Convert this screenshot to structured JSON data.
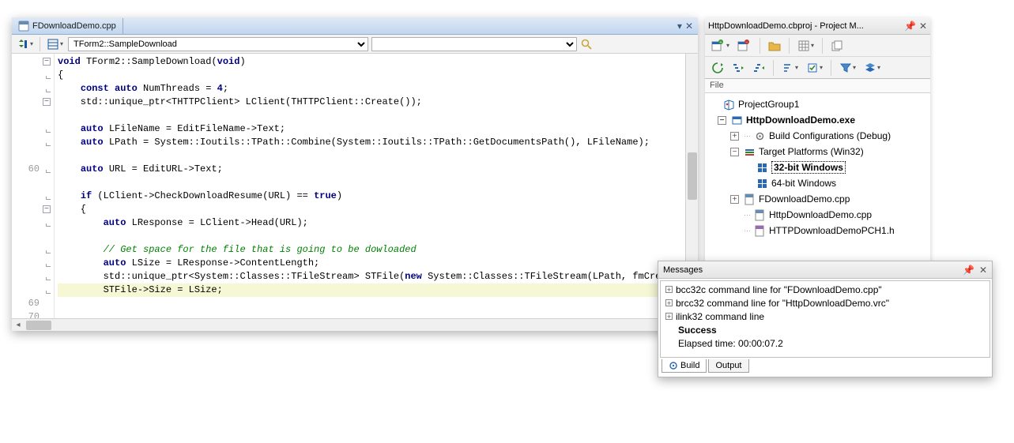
{
  "editor": {
    "tab_label": "FDownloadDemo.cpp",
    "nav_combo": "TForm2::SampleDownload",
    "line_numbers": [
      "",
      "",
      "",
      "",
      "",
      "",
      "",
      "",
      "60",
      "",
      "",
      "",
      "",
      "",
      "",
      "",
      "",
      "",
      "69",
      "70"
    ],
    "code_lines": [
      {
        "t": "[[kw:void]] TForm2::SampleDownload([[kw:void]])"
      },
      {
        "t": "{"
      },
      {
        "t": "    [[kw:const auto]] NumThreads = [[num:4]];"
      },
      {
        "t": "    std::unique_ptr<THTTPClient> LClient(THTTPClient::Create());"
      },
      {
        "t": ""
      },
      {
        "t": "    [[kw:auto]] LFileName = EditFileName->Text;"
      },
      {
        "t": "    [[kw:auto]] LPath = System::Ioutils::TPath::Combine(System::Ioutils::TPath::GetDocumentsPath(), LFileName);"
      },
      {
        "t": ""
      },
      {
        "t": "    [[kw:auto]] URL = EditURL->Text;"
      },
      {
        "t": ""
      },
      {
        "t": "    [[kw:if]] (LClient->CheckDownloadResume(URL) == [[kw:true]])"
      },
      {
        "t": "    {"
      },
      {
        "t": "        [[kw:auto]] LResponse = LClient->Head(URL);"
      },
      {
        "t": ""
      },
      {
        "t": "        [[cmt:// Get space for the file that is going to be dowloaded]]"
      },
      {
        "t": "        [[kw:auto]] LSize = LResponse->ContentLength;"
      },
      {
        "t": "        std::unique_ptr<System::Classes::TFileStream> STFile([[kw:new]] System::Classes::TFileStream(LPath, fmCreate));"
      },
      {
        "t": "        STFile->Size = LSize;",
        "hl": true
      },
      {
        "t": ""
      }
    ],
    "fold_marks": [
      {
        "line": 0,
        "type": "minus"
      },
      {
        "line": 1,
        "type": "line"
      },
      {
        "line": 2,
        "type": "line"
      },
      {
        "line": 3,
        "type": "minus"
      },
      {
        "line": 5,
        "type": "line"
      },
      {
        "line": 6,
        "type": "line"
      },
      {
        "line": 8,
        "type": "line"
      },
      {
        "line": 10,
        "type": "line"
      },
      {
        "line": 11,
        "type": "minus"
      },
      {
        "line": 12,
        "type": "line"
      },
      {
        "line": 14,
        "type": "line"
      },
      {
        "line": 15,
        "type": "line"
      },
      {
        "line": 16,
        "type": "line"
      },
      {
        "line": 17,
        "type": "line"
      }
    ]
  },
  "projman": {
    "title": "HttpDownloadDemo.cbproj - Project M...",
    "heading": "File",
    "tree": [
      {
        "indent": 0,
        "label": "ProjectGroup1",
        "icon": "group",
        "exp": "blank"
      },
      {
        "indent": 1,
        "label": "HttpDownloadDemo.exe",
        "icon": "exe",
        "bold": true,
        "exp": "minus"
      },
      {
        "indent": 2,
        "label": "Build Configurations (Debug)",
        "icon": "gear",
        "exp": "plus",
        "dots": true
      },
      {
        "indent": 2,
        "label": "Target Platforms (Win32)",
        "icon": "target",
        "exp": "minus"
      },
      {
        "indent": 3,
        "label": "32-bit Windows",
        "icon": "win",
        "sel": true
      },
      {
        "indent": 3,
        "label": "64-bit Windows",
        "icon": "win"
      },
      {
        "indent": 2,
        "label": "FDownloadDemo.cpp",
        "icon": "cpp",
        "exp": "plus"
      },
      {
        "indent": 2,
        "label": "HttpDownloadDemo.cpp",
        "icon": "cpp",
        "dots": true
      },
      {
        "indent": 2,
        "label": "HTTPDownloadDemoPCH1.h",
        "icon": "h",
        "dots": true
      }
    ]
  },
  "messages": {
    "title": "Messages",
    "rows": [
      {
        "exp": true,
        "text": "bcc32c command line for \"FDownloadDemo.cpp\""
      },
      {
        "exp": true,
        "text": "brcc32 command line for \"HttpDownloadDemo.vrc\""
      },
      {
        "exp": true,
        "text": "ilink32 command line"
      },
      {
        "bold": true,
        "indent": true,
        "text": "Success"
      },
      {
        "indent": true,
        "text": "Elapsed time: 00:00:07.2"
      }
    ],
    "tabs": {
      "build": "Build",
      "output": "Output"
    }
  }
}
